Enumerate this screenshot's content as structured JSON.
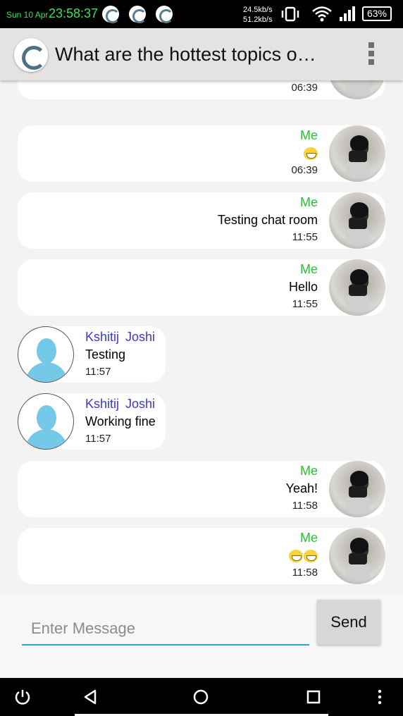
{
  "status_bar": {
    "date": "Sun 10 Apr",
    "time": "23:58:37",
    "speed_up": "24.5kb/s",
    "speed_down": "51.2kb/s",
    "battery": "63%",
    "icons": [
      "app-notification-icon",
      "app-notification-icon",
      "app-notification-icon",
      "vibrate-icon",
      "wifi-icon",
      "signal-icon",
      "battery-icon"
    ]
  },
  "app_bar": {
    "title": "What are the hottest topics o…",
    "icons": [
      "app-logo-icon",
      "overflow-menu-icon"
    ]
  },
  "messages": [
    {
      "sender": "",
      "text": "",
      "time": "06:39",
      "is_me": true
    },
    {
      "sender": "Me",
      "text": "😁",
      "time": "06:39",
      "is_me": true
    },
    {
      "sender": "Me",
      "text": "Testing chat room",
      "time": "11:55",
      "is_me": true
    },
    {
      "sender": "Me",
      "text": "Hello",
      "time": "11:55",
      "is_me": true
    },
    {
      "sender": "Kshitij  Joshi",
      "text": "Testing",
      "time": "11:57",
      "is_me": false
    },
    {
      "sender": "Kshitij  Joshi",
      "text": "Working fine",
      "time": "11:57",
      "is_me": false
    },
    {
      "sender": "Me",
      "text": "Yeah!",
      "time": "11:58",
      "is_me": true
    },
    {
      "sender": "Me",
      "text": "😁😁",
      "time": "11:58",
      "is_me": true
    }
  ],
  "composer": {
    "placeholder": "Enter Message",
    "value": "",
    "send_label": "Send"
  },
  "nav_bar": {
    "icons": [
      "power-icon",
      "back-icon",
      "home-icon",
      "recents-icon",
      "menu-icon"
    ]
  }
}
